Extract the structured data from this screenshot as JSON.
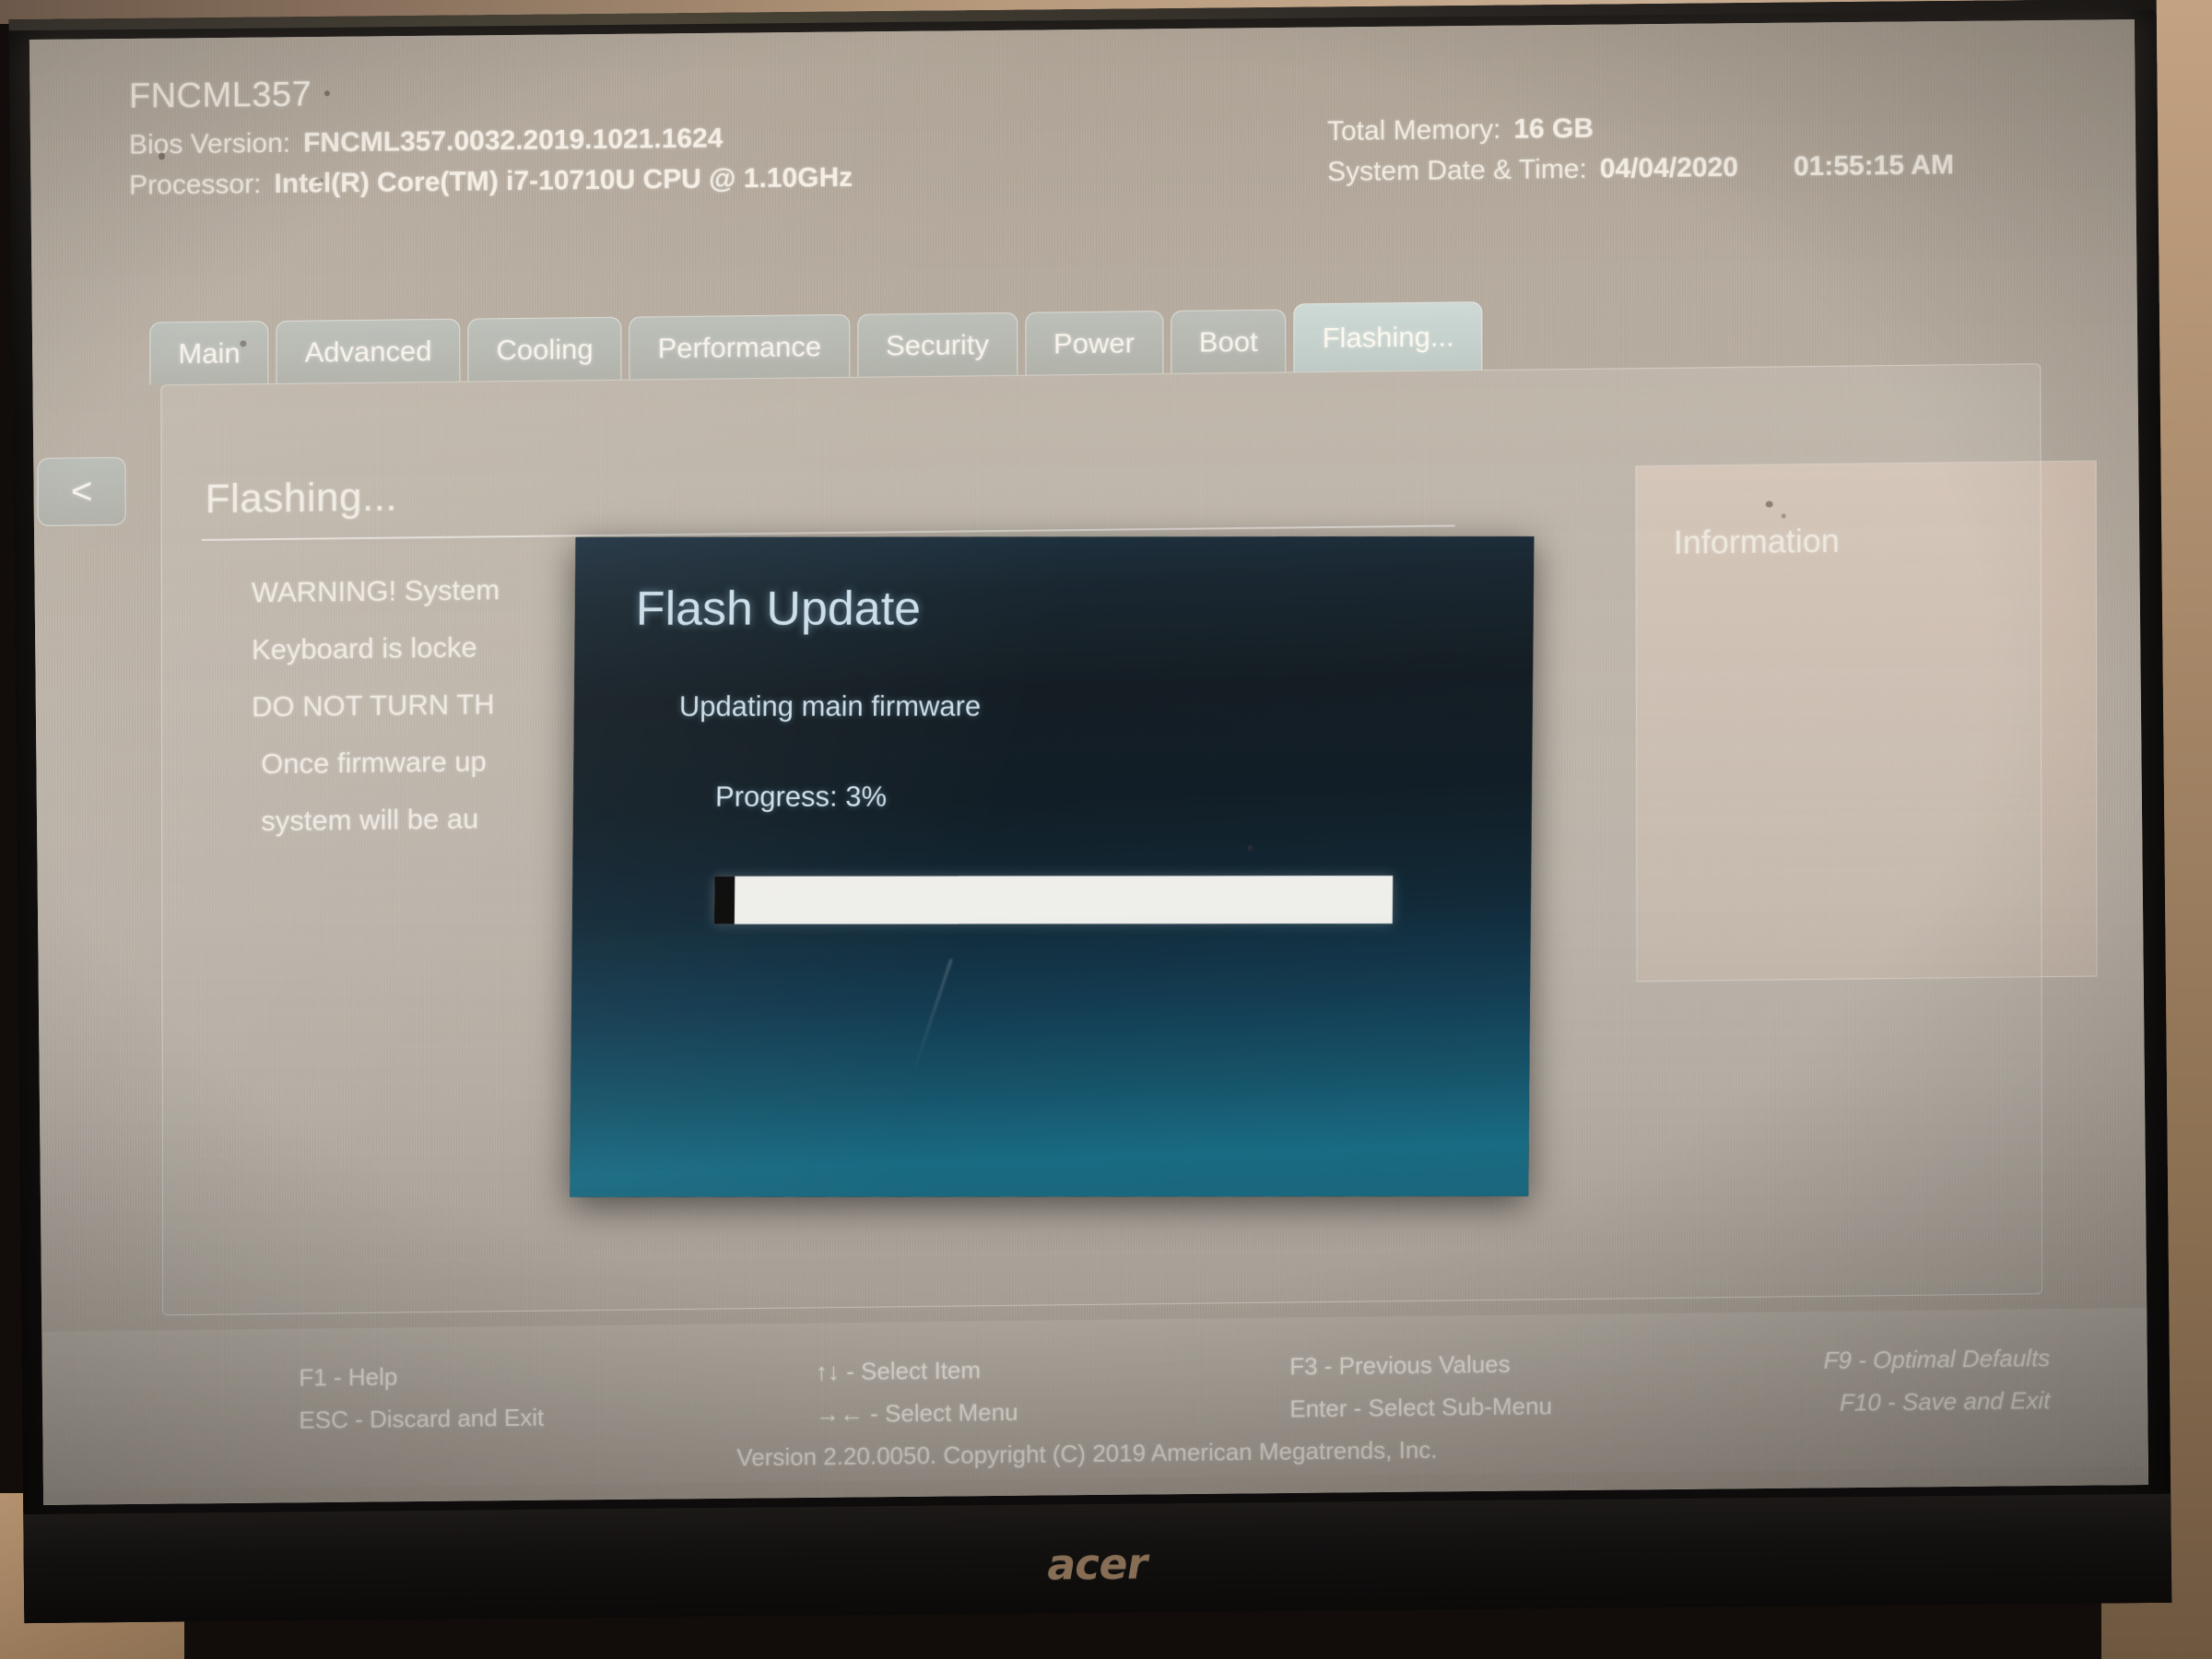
{
  "system": {
    "machine_name": "FNCML357",
    "bios_version_label": "Bios Version:",
    "bios_version_value": "FNCML357.0032.2019.1021.1624",
    "processor_label": "Processor:",
    "processor_value": "Intel(R) Core(TM) i7-10710U CPU @ 1.10GHz",
    "total_memory_label": "Total Memory:",
    "total_memory_value": "16 GB",
    "datetime_label": "System Date & Time:",
    "date_value": "04/04/2020",
    "time_value": "01:55:15 AM"
  },
  "tabs": [
    {
      "label": "Main",
      "active": false
    },
    {
      "label": "Advanced",
      "active": false
    },
    {
      "label": "Cooling",
      "active": false
    },
    {
      "label": "Performance",
      "active": false
    },
    {
      "label": "Security",
      "active": false
    },
    {
      "label": "Power",
      "active": false
    },
    {
      "label": "Boot",
      "active": false
    },
    {
      "label": "Flashing...",
      "active": true
    }
  ],
  "nav": {
    "back_glyph": "<"
  },
  "page": {
    "title": "Flashing...",
    "warning_lines": [
      "WARNING! System",
      "Keyboard is locke",
      "DO NOT TURN TH",
      "Once firmware up",
      "system will be au"
    ]
  },
  "info_panel": {
    "title": "Information"
  },
  "dialog": {
    "title": "Flash Update",
    "status": "Updating main firmware",
    "progress_label": "Progress: 3%",
    "progress_percent": 3,
    "track_color": "#f5f5f2",
    "fill_color": "#0b0b0b"
  },
  "footer": {
    "col1": [
      "F1 - Help",
      "ESC - Discard and Exit"
    ],
    "col2": [
      "↑↓ - Select Item",
      "→← - Select Menu"
    ],
    "col3": [
      "F3 - Previous Values",
      "Enter - Select Sub-Menu"
    ],
    "col4": [
      "F9 - Optimal Defaults",
      "F10 - Save and Exit"
    ],
    "copyright": "Version 2.20.0050. Copyright (C) 2019 American Megatrends, Inc."
  },
  "hardware": {
    "monitor_brand": "acer"
  }
}
